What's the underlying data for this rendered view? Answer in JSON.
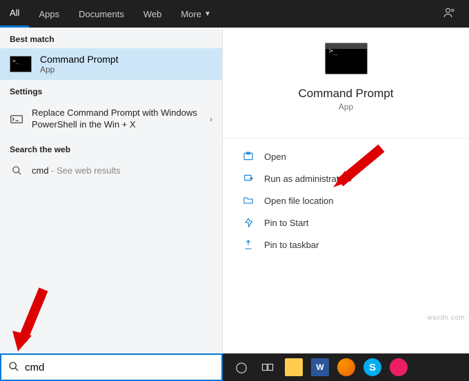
{
  "tabs": {
    "all": "All",
    "apps": "Apps",
    "documents": "Documents",
    "web": "Web",
    "more": "More"
  },
  "left": {
    "best_match_header": "Best match",
    "best_match": {
      "title": "Command Prompt",
      "sub": "App"
    },
    "settings_header": "Settings",
    "setting_text": "Replace Command Prompt with Windows PowerShell in the Win + X",
    "search_web_header": "Search the web",
    "web_query": "cmd",
    "web_sub": " - See web results"
  },
  "right": {
    "title": "Command Prompt",
    "sub": "App",
    "actions": {
      "open": "Open",
      "run_admin": "Run as administrator",
      "open_loc": "Open file location",
      "pin_start": "Pin to Start",
      "pin_taskbar": "Pin to taskbar"
    }
  },
  "search": {
    "value": "cmd"
  },
  "watermark": "wsxdn.com"
}
